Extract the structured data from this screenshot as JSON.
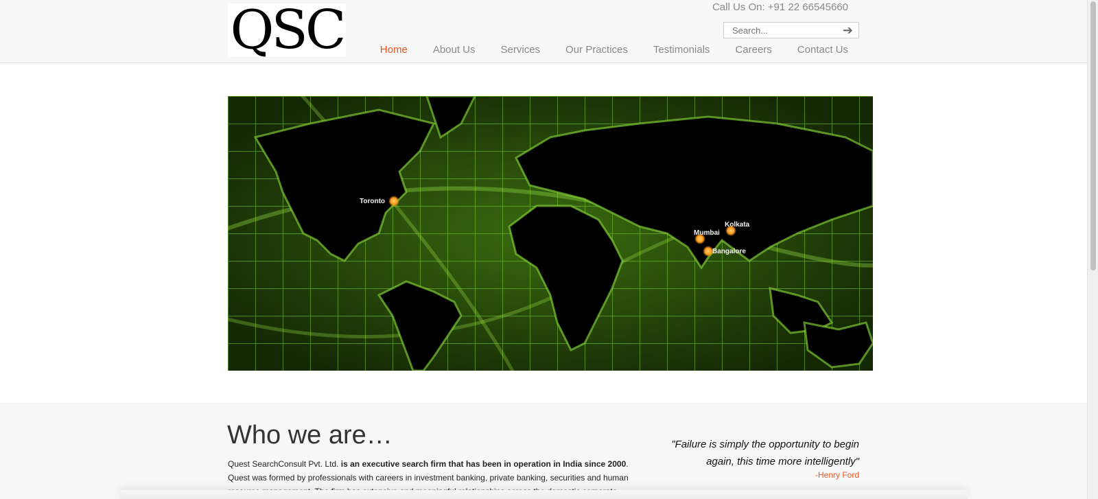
{
  "header": {
    "logo_text": "QSC",
    "phone": "Call Us On: +91 22 66545660",
    "search_placeholder": "Search...",
    "search_button_icon": "arrow-right-icon"
  },
  "nav": {
    "items": [
      {
        "label": "Home",
        "active": true
      },
      {
        "label": "About Us"
      },
      {
        "label": "Services"
      },
      {
        "label": "Our Practices"
      },
      {
        "label": "Testimonials"
      },
      {
        "label": "Careers"
      },
      {
        "label": "Contact Us"
      }
    ]
  },
  "hero": {
    "cities": [
      {
        "name": "Toronto"
      },
      {
        "name": "Mumbai"
      },
      {
        "name": "Kolkata"
      },
      {
        "name": "Bangalore"
      }
    ]
  },
  "who": {
    "title": "Who we are…",
    "company": "Quest SearchConsult Pvt. Ltd.",
    "bold_text": "is an executive search firm that has been in operation in India since 2000",
    "period": ".",
    "rest_text": "Quest was formed by professionals with careers in investment banking, private banking, securities and human resource management. The firm has extensive and meaningful relationships across the domestic corporate"
  },
  "quote": {
    "text": "\"Failure is simply the opportunity to begin again, this time more intelligently\"",
    "author": "-Henry Ford"
  },
  "colors": {
    "accent": "#e8561e",
    "nav_text": "#888888",
    "map_green": "#7bd12a"
  }
}
